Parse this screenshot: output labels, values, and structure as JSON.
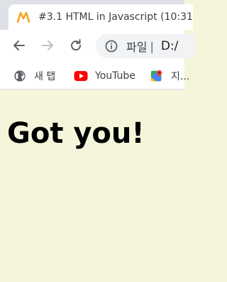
{
  "browser": {
    "tab": {
      "title": "#3.1 HTML in Javascript (10:31",
      "favicon": "nomad-coders-logo"
    },
    "toolbar": {
      "back_icon": "arrow-left-icon",
      "forward_icon": "arrow-right-icon",
      "reload_icon": "reload-icon",
      "security_label": "파일",
      "address": "D:/"
    },
    "bookmarks": [
      {
        "icon": "globe-icon",
        "label": "새 탭"
      },
      {
        "icon": "youtube-icon",
        "label": "YouTube"
      },
      {
        "icon": "google-maps-icon",
        "label": "지..."
      }
    ]
  },
  "page": {
    "heading": "Got you!",
    "background_color": "#f5f5dc"
  },
  "colors": {
    "tab_strip": "#dee1e6",
    "omnibox": "#f1f3f4",
    "favicon": "#f5a623",
    "youtube_red": "#ff0000"
  }
}
